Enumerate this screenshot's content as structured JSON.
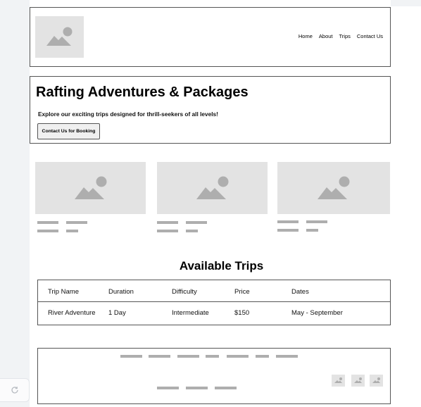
{
  "header": {
    "logo_icon": "image-placeholder-icon",
    "nav": [
      "Home",
      "About",
      "Trips",
      "Contact Us"
    ]
  },
  "hero": {
    "title": "Rafting Adventures & Packages",
    "subtitle": "Explore our exciting trips designed for thrill-seekers of all levels!",
    "button_label": "Contact Us for Booking"
  },
  "cards": [
    {
      "image_icon": "image-placeholder-icon"
    },
    {
      "image_icon": "image-placeholder-icon"
    },
    {
      "image_icon": "image-placeholder-icon"
    }
  ],
  "trips": {
    "heading": "Available Trips",
    "columns": [
      "Trip Name",
      "Duration",
      "Difficulty",
      "Price",
      "Dates"
    ],
    "rows": [
      [
        "River Adventure",
        "1 Day",
        "Intermediate",
        "$150",
        "May - September"
      ]
    ]
  },
  "footer": {
    "social_icons": [
      "image-placeholder-icon",
      "image-placeholder-icon",
      "image-placeholder-icon"
    ]
  },
  "colors": {
    "placeholder": "#e3e3e3",
    "placeholder_glyph": "#aeaeae",
    "border": "#555555",
    "sidebar": "#f1f3f5"
  }
}
